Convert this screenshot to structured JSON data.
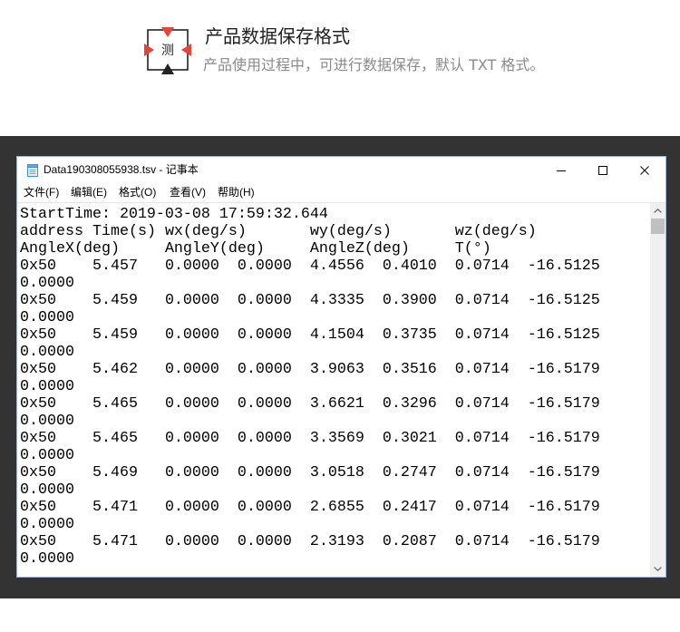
{
  "theme": {
    "accent": "#e5443c",
    "backdrop": "#333333"
  },
  "icons": {
    "badge": "measure-badge-icon",
    "app": "notepad-icon",
    "minimize": "minimize-icon",
    "maximize": "maximize-icon",
    "close": "close-icon",
    "scroll_up": "chevron-up-icon",
    "scroll_down": "chevron-down-icon"
  },
  "header": {
    "icon_char": "测",
    "title": "产品数据保存格式",
    "subtitle": "产品使用过程中，可进行数据保存，默认 TXT 格式。"
  },
  "window": {
    "title": "Data190308055938.tsv - 记事本",
    "menu": [
      "文件(F)",
      "编辑(E)",
      "格式(O)",
      "查看(V)",
      "帮助(H)"
    ],
    "scrollbar": {
      "position": 0
    }
  },
  "editor": {
    "lines": [
      [
        "StartTime: 2019-03-08 17:59:32.644"
      ],
      [
        "address",
        "Time(s)",
        "wx(deg/s)",
        "wy(deg/s)",
        "wz(deg/s)"
      ],
      [
        "AngleX(deg)",
        "AngleY(deg)",
        "AngleZ(deg)",
        "T(°)"
      ],
      [
        "0x50",
        "5.457",
        "0.0000",
        "0.0000",
        "4.4556",
        "0.4010",
        "0.0714",
        "-16.5125"
      ],
      [
        "0.0000"
      ],
      [
        "0x50",
        "5.459",
        "0.0000",
        "0.0000",
        "4.3335",
        "0.3900",
        "0.0714",
        "-16.5125"
      ],
      [
        "0.0000"
      ],
      [
        "0x50",
        "5.459",
        "0.0000",
        "0.0000",
        "4.1504",
        "0.3735",
        "0.0714",
        "-16.5125"
      ],
      [
        "0.0000"
      ],
      [
        "0x50",
        "5.462",
        "0.0000",
        "0.0000",
        "3.9063",
        "0.3516",
        "0.0714",
        "-16.5179"
      ],
      [
        "0.0000"
      ],
      [
        "0x50",
        "5.465",
        "0.0000",
        "0.0000",
        "3.6621",
        "0.3296",
        "0.0714",
        "-16.5179"
      ],
      [
        "0.0000"
      ],
      [
        "0x50",
        "5.465",
        "0.0000",
        "0.0000",
        "3.3569",
        "0.3021",
        "0.0714",
        "-16.5179"
      ],
      [
        "0.0000"
      ],
      [
        "0x50",
        "5.469",
        "0.0000",
        "0.0000",
        "3.0518",
        "0.2747",
        "0.0714",
        "-16.5179"
      ],
      [
        "0.0000"
      ],
      [
        "0x50",
        "5.471",
        "0.0000",
        "0.0000",
        "2.6855",
        "0.2417",
        "0.0714",
        "-16.5179"
      ],
      [
        "0.0000"
      ],
      [
        "0x50",
        "5.471",
        "0.0000",
        "0.0000",
        "2.3193",
        "0.2087",
        "0.0714",
        "-16.5179"
      ],
      [
        "0.0000"
      ]
    ]
  }
}
